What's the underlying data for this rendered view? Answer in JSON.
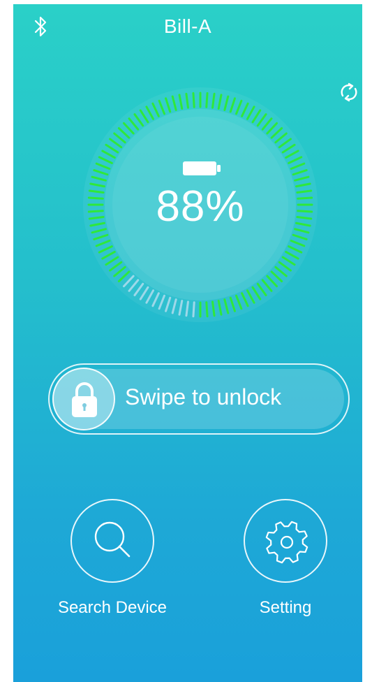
{
  "header": {
    "title": "Bill-A",
    "bluetooth_icon": "bluetooth-icon"
  },
  "refresh_icon": "refresh-icon",
  "battery": {
    "icon": "battery-icon",
    "percent_text": "88%",
    "level": 0.88
  },
  "gauge_colors": {
    "active": "#2fe83a",
    "inactive": "#b9dff0"
  },
  "swipe": {
    "label": "Swipe to unlock",
    "icon": "lock-icon"
  },
  "actions": [
    {
      "label": "Search Device",
      "icon": "search-icon"
    },
    {
      "label": "Setting",
      "icon": "gear-icon"
    }
  ]
}
